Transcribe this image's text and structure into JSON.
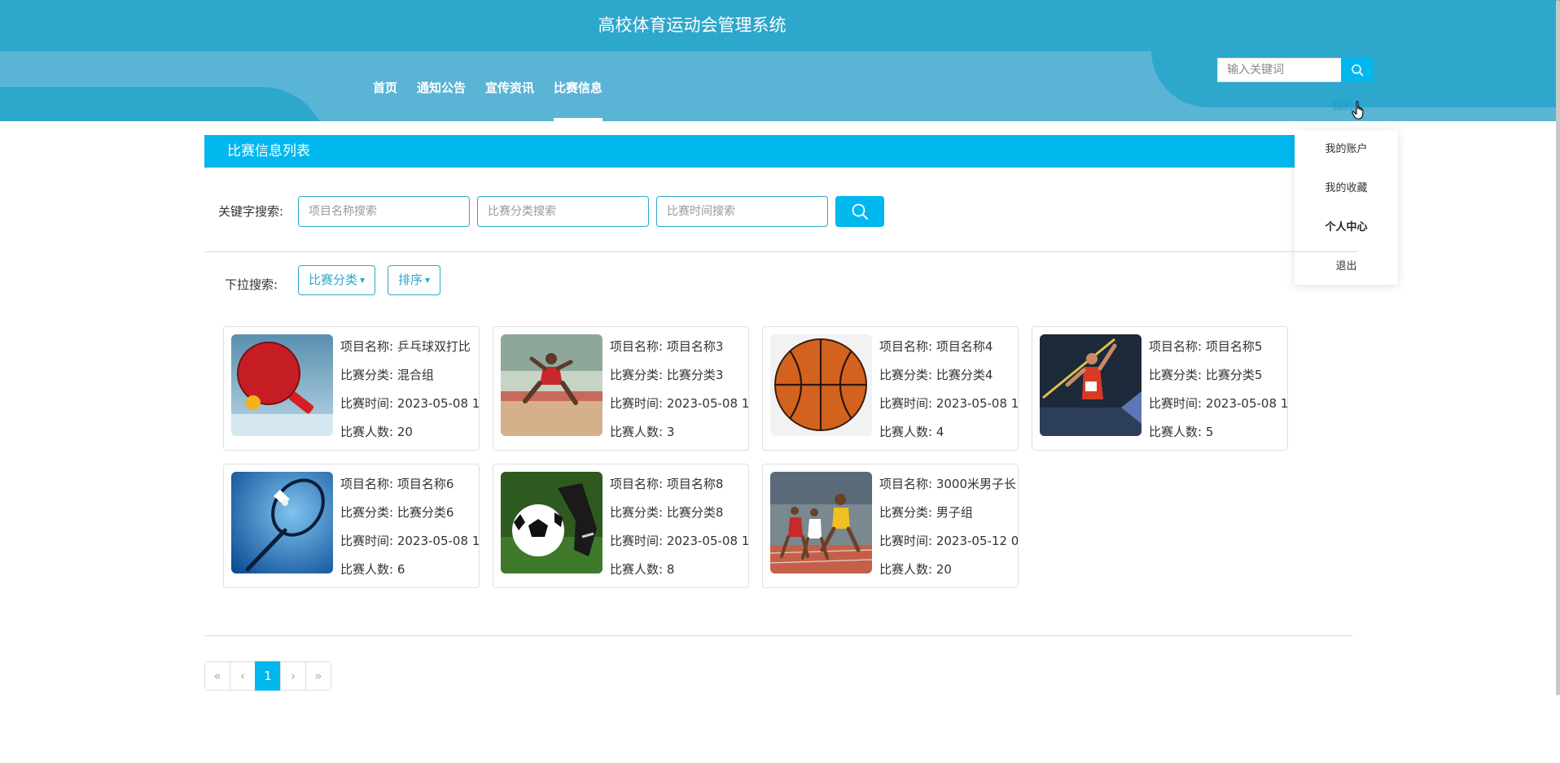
{
  "header": {
    "site_title": "高校体育运动会管理系统",
    "nav": [
      {
        "label": "首页"
      },
      {
        "label": "通知公告"
      },
      {
        "label": "宣传资讯"
      },
      {
        "label": "比赛信息"
      }
    ],
    "active_nav": "比赛信息",
    "search_placeholder": "输入关键词",
    "user_menu_label": "我的"
  },
  "user_dropdown": {
    "items": [
      {
        "label": "我的账户"
      },
      {
        "label": "我的收藏"
      },
      {
        "label": "个人中心"
      },
      {
        "label": "退出"
      }
    ]
  },
  "section_title": "比赛信息列表",
  "search": {
    "label": "关键字搜索:",
    "placeholders": [
      "项目名称搜索",
      "比赛分类搜索",
      "比赛时间搜索"
    ]
  },
  "filters": {
    "label": "下拉搜索:",
    "buttons": [
      {
        "label": "比赛分类"
      },
      {
        "label": "排序"
      }
    ]
  },
  "field_labels": {
    "name": "项目名称: ",
    "category": "比赛分类: ",
    "time": "比赛时间: ",
    "count": "比赛人数: "
  },
  "cards": [
    {
      "name": "乒乓球双打比",
      "category": "混合组",
      "time": "2023-05-08 1",
      "count": "20",
      "image": "table-tennis"
    },
    {
      "name": "项目名称3",
      "category": "比赛分类3",
      "time": "2023-05-08 1",
      "count": "3",
      "image": "long-jump"
    },
    {
      "name": "项目名称4",
      "category": "比赛分类4",
      "time": "2023-05-08 1",
      "count": "4",
      "image": "basketball"
    },
    {
      "name": "项目名称5",
      "category": "比赛分类5",
      "time": "2023-05-08 1",
      "count": "5",
      "image": "javelin"
    },
    {
      "name": "项目名称6",
      "category": "比赛分类6",
      "time": "2023-05-08 1",
      "count": "6",
      "image": "badminton"
    },
    {
      "name": "项目名称8",
      "category": "比赛分类8",
      "time": "2023-05-08 1",
      "count": "8",
      "image": "soccer"
    },
    {
      "name": "3000米男子长",
      "category": "男子组",
      "time": "2023-05-12 0",
      "count": "20",
      "image": "running"
    }
  ],
  "pagination": {
    "first": "«",
    "prev": "‹",
    "current": "1",
    "next": "›",
    "last": "»"
  },
  "colors": {
    "header": "#2ea7cd",
    "accent": "#00b7ee"
  }
}
